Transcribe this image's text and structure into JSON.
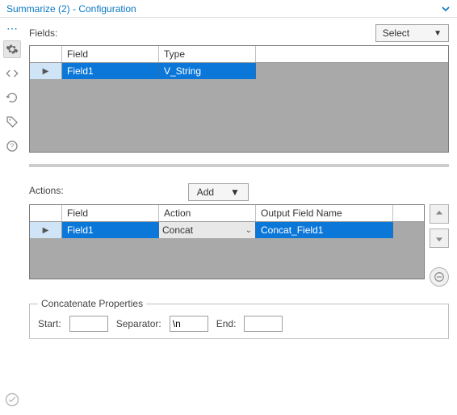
{
  "title": "Summarize (2) - Configuration",
  "select_button": "Select",
  "fields_label": "Fields:",
  "fields_table": {
    "headers": {
      "field": "Field",
      "type": "Type"
    },
    "rows": [
      {
        "field": "Field1",
        "type": "V_String"
      }
    ]
  },
  "actions_label": "Actions:",
  "add_button": "Add",
  "actions_table": {
    "headers": {
      "field": "Field",
      "action": "Action",
      "output": "Output Field Name"
    },
    "rows": [
      {
        "field": "Field1",
        "action": "Concat",
        "output": "Concat_Field1"
      }
    ]
  },
  "concat": {
    "legend": "Concatenate Properties",
    "start_label": "Start:",
    "start_value": "",
    "separator_label": "Separator:",
    "separator_value": "\\n",
    "end_label": "End:",
    "end_value": ""
  }
}
